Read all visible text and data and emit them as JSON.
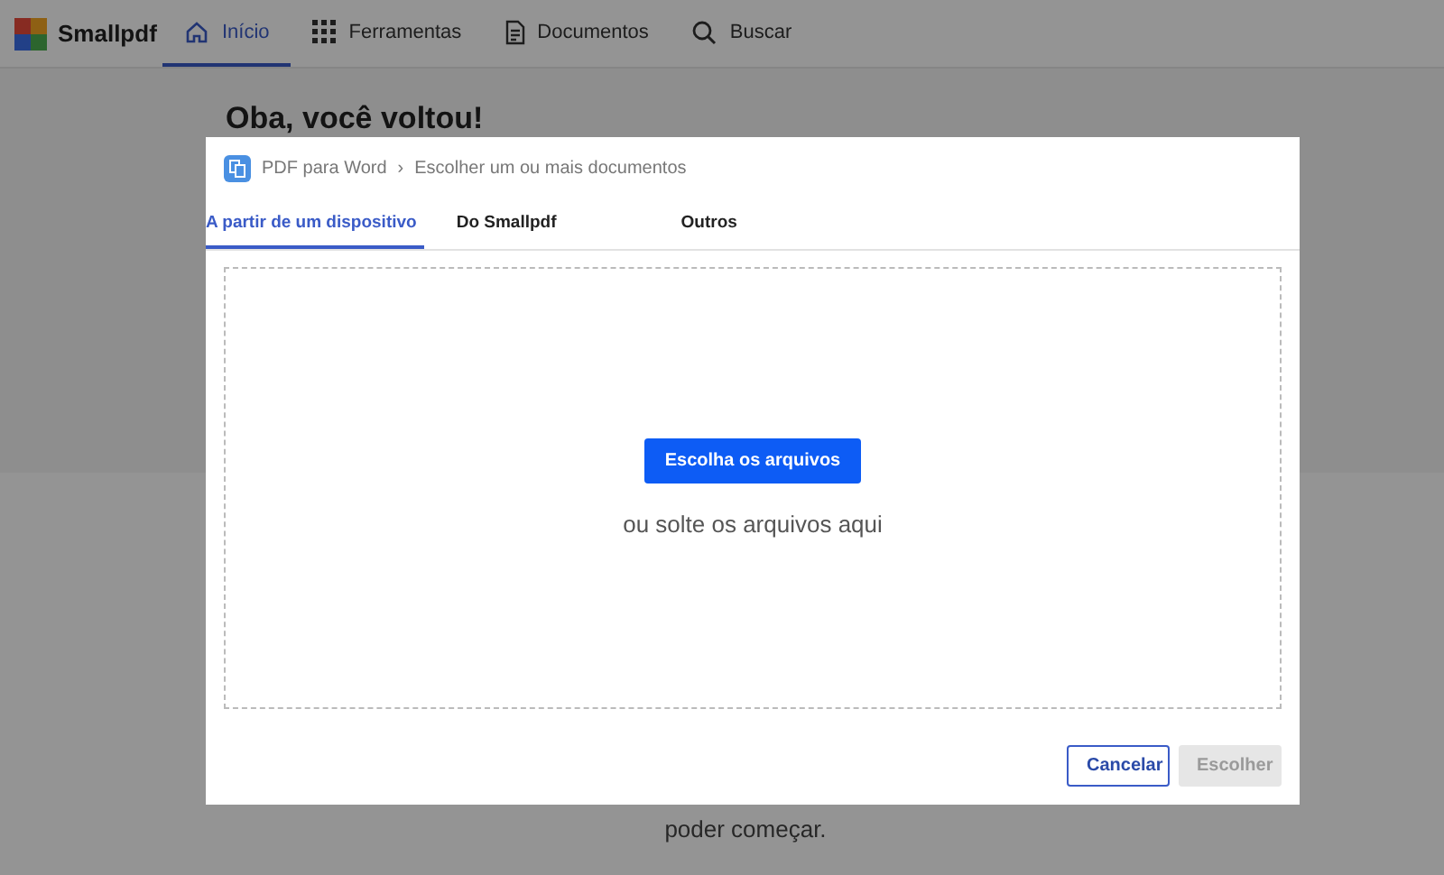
{
  "header": {
    "logo": "Smallpdf",
    "nav": [
      {
        "label": "Início",
        "selected": true
      },
      {
        "label": "Ferramentas",
        "selected": false
      },
      {
        "label": "Documentos",
        "selected": false
      },
      {
        "label": "Buscar",
        "selected": false
      }
    ]
  },
  "page": {
    "greeting": "Oba, você voltou!",
    "footer_text": "poder começar."
  },
  "dialog": {
    "breadcrumb_separator": "›",
    "breadcrumb": [
      "PDF para Word",
      "Escolher um ou mais documentos"
    ],
    "tabs": [
      {
        "label": "A partir de um dispositivo",
        "selected": true
      },
      {
        "label": "Do Smallpdf",
        "selected": false
      },
      {
        "label": "Outros",
        "selected": false
      }
    ],
    "upload_button": "Escolha os arquivos",
    "drop_hint": "ou solte os arquivos aqui",
    "buttons": [
      {
        "label": "Cancelar",
        "disabled": false
      },
      {
        "label": "Escolher",
        "disabled": true
      }
    ]
  }
}
